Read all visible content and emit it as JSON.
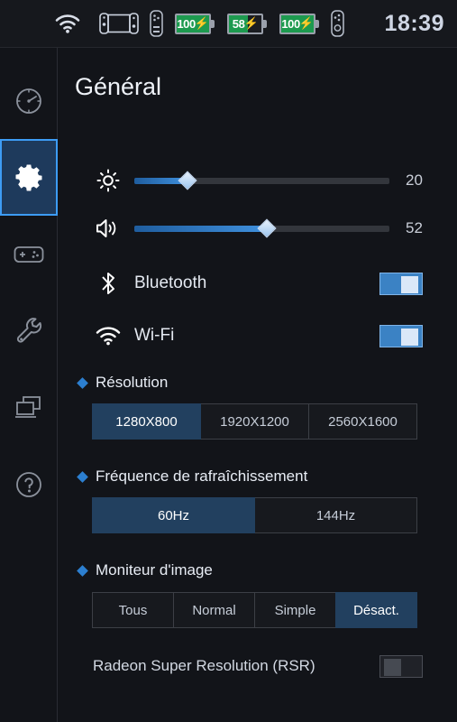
{
  "statusbar": {
    "icons": [
      "wifi-icon",
      "handheld-device-icon",
      "left-joycon-icon",
      "right-joycon-icon"
    ],
    "batteries": [
      {
        "name": "battery-1",
        "level": "100",
        "percent": 100,
        "charging": true
      },
      {
        "name": "battery-2",
        "level": "58",
        "percent": 58,
        "charging": true
      },
      {
        "name": "battery-3",
        "level": "100",
        "percent": 100,
        "charging": true
      }
    ],
    "charging_glyph": "⚡",
    "clock": "18:39"
  },
  "sidebar": {
    "items": [
      {
        "icon": "performance-gauge-icon",
        "selected": false
      },
      {
        "icon": "gear-icon",
        "selected": true
      },
      {
        "icon": "gamepad-icon",
        "selected": false
      },
      {
        "icon": "wrench-icon",
        "selected": false
      },
      {
        "icon": "display-windows-icon",
        "selected": false
      },
      {
        "icon": "help-circle-icon",
        "selected": false
      }
    ]
  },
  "main": {
    "title": "Général",
    "sliders": [
      {
        "name": "brightness",
        "icon": "brightness-icon",
        "value": "20",
        "percent": 21
      },
      {
        "name": "volume",
        "icon": "volume-icon",
        "value": "52",
        "percent": 52
      }
    ],
    "toggles": [
      {
        "name": "bluetooth",
        "icon": "bluetooth-icon",
        "label": "Bluetooth",
        "on": true
      },
      {
        "name": "wifi",
        "icon": "wifi-icon",
        "label": "Wi-Fi",
        "on": true
      }
    ],
    "sections": [
      {
        "name": "resolution",
        "title": "Résolution",
        "options": [
          "1280X800",
          "1920X1200",
          "2560X1600"
        ],
        "selected": 0
      },
      {
        "name": "refresh-rate",
        "title": "Fréquence de rafraîchissement",
        "options": [
          "60Hz",
          "144Hz"
        ],
        "selected": 0
      },
      {
        "name": "image-monitor",
        "title": "Moniteur d'image",
        "options": [
          "Tous",
          "Normal",
          "Simple",
          "Désact."
        ],
        "selected": 3
      }
    ],
    "rsr": {
      "label": "Radeon Super Resolution (RSR)",
      "on": false
    }
  },
  "colors": {
    "background": "#121419",
    "statusbar": "#16181d",
    "accent": "#3d9cf5",
    "selected_segment": "#22405f",
    "toggle_on": "#3b82c4",
    "battery_green": "#1d9a4f",
    "diamond_blue": "#2c7fd0"
  }
}
